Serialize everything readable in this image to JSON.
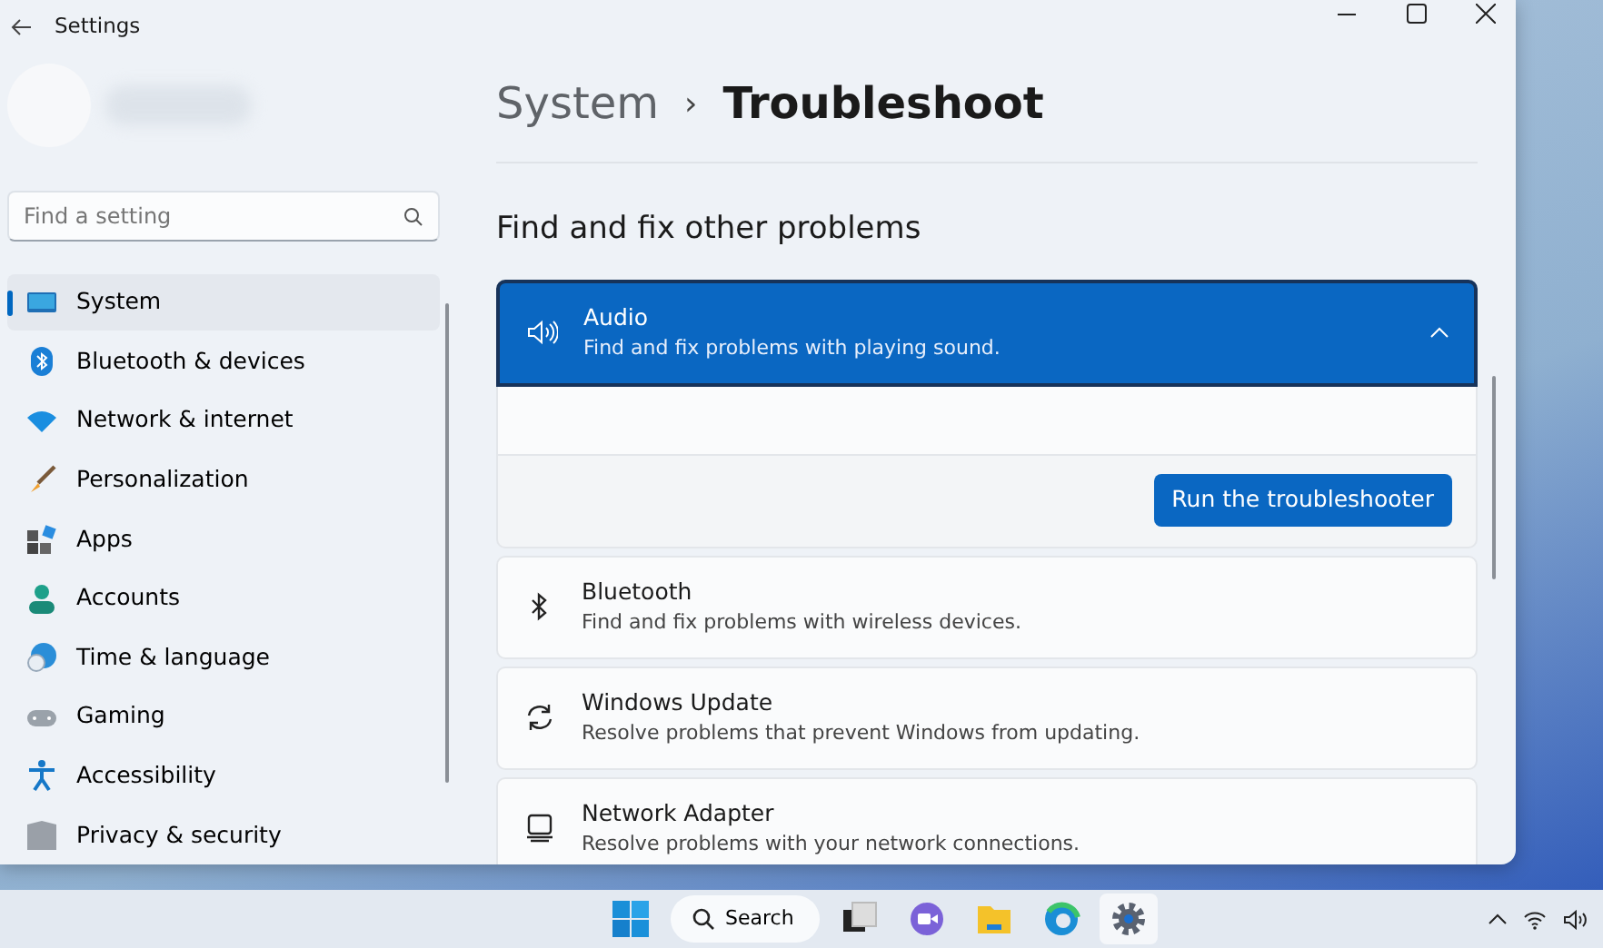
{
  "window": {
    "title": "Settings"
  },
  "search": {
    "placeholder": "Find a setting"
  },
  "sidebar": {
    "items": [
      {
        "label": "System",
        "kind": "system",
        "selected": true
      },
      {
        "label": "Bluetooth & devices",
        "kind": "bluetooth",
        "selected": false
      },
      {
        "label": "Network & internet",
        "kind": "network",
        "selected": false
      },
      {
        "label": "Personalization",
        "kind": "brush",
        "selected": false
      },
      {
        "label": "Apps",
        "kind": "apps",
        "selected": false
      },
      {
        "label": "Accounts",
        "kind": "accounts",
        "selected": false
      },
      {
        "label": "Time & language",
        "kind": "time",
        "selected": false
      },
      {
        "label": "Gaming",
        "kind": "gaming",
        "selected": false
      },
      {
        "label": "Accessibility",
        "kind": "accessibility",
        "selected": false
      },
      {
        "label": "Privacy & security",
        "kind": "privacy",
        "selected": false
      }
    ]
  },
  "breadcrumb": {
    "parent": "System",
    "separator": "›",
    "current": "Troubleshoot"
  },
  "section_title": "Find and fix other problems",
  "troubleshooters": [
    {
      "kind": "audio",
      "title": "Audio",
      "description": "Find and fix problems with playing sound.",
      "expanded": true,
      "button": "Run the troubleshooter"
    },
    {
      "kind": "bluetooth",
      "title": "Bluetooth",
      "description": "Find and fix problems with wireless devices.",
      "expanded": false
    },
    {
      "kind": "update",
      "title": "Windows Update",
      "description": "Resolve problems that prevent Windows from updating.",
      "expanded": false
    },
    {
      "kind": "adapter",
      "title": "Network Adapter",
      "description": "Resolve problems with your network connections.",
      "expanded": false
    }
  ],
  "taskbar": {
    "search_label": "Search",
    "apps": [
      {
        "kind": "taskview",
        "selected": false
      },
      {
        "kind": "chat",
        "selected": false
      },
      {
        "kind": "explorer",
        "selected": false
      },
      {
        "kind": "edge",
        "selected": false
      },
      {
        "kind": "settings",
        "selected": true
      }
    ]
  }
}
